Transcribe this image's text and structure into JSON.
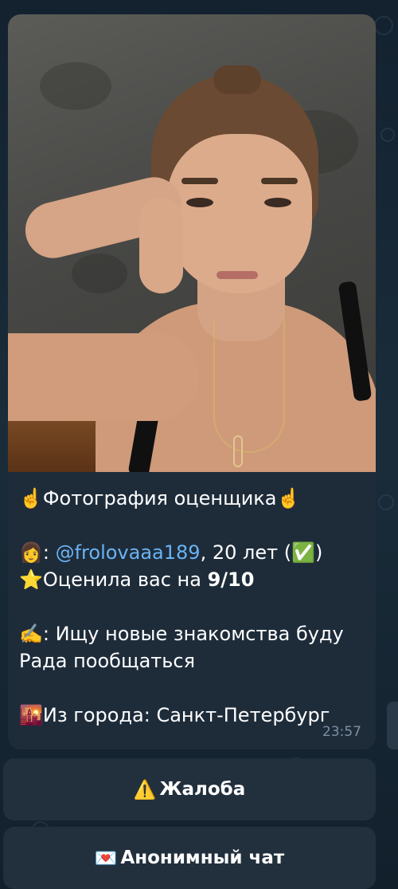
{
  "message": {
    "title_line": "☝️Фотография оценщика☝️",
    "profile_emoji": "👩",
    "username_prefix": ": ",
    "username": "@frolovaaa189",
    "age_text": ", 20 лет (",
    "verified": "✅",
    "age_close": ")",
    "rating_emoji": "⭐",
    "rating_text": "Оценила вас на ",
    "rating_value": "9/10",
    "about_emoji": "✍️",
    "about_text": ": Ищу новые знакомства буду Рада пообщаться",
    "city_emoji": "🌇",
    "city_text": "Из города: Санкт-Петербург",
    "time": "23:57"
  },
  "buttons": {
    "report_icon": "⚠️",
    "report_label": "Жалоба",
    "anon_icon": "💌",
    "anon_label": "Анонимный чат"
  },
  "colors": {
    "background": "#0f1a24",
    "bubble": "#1e2c3a",
    "link": "#6ab3f3",
    "button": "#22303d"
  }
}
